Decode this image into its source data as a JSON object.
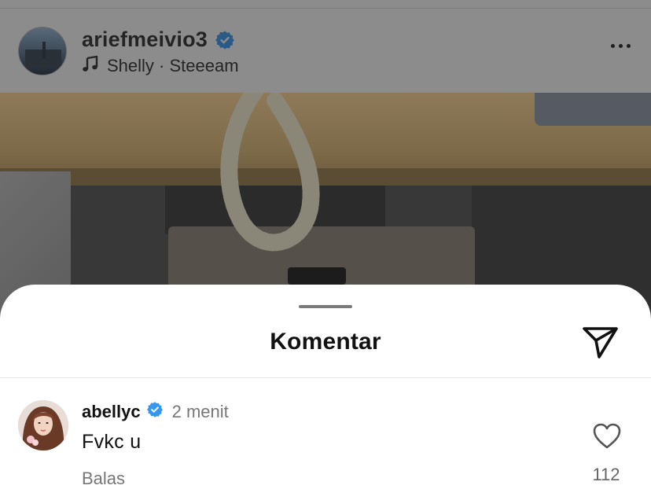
{
  "post": {
    "username": "ariefmeivio3",
    "music": "Shelly · Steeeam"
  },
  "sheet": {
    "title": "Komentar"
  },
  "comment": {
    "username": "abellyc",
    "time": "2 menit",
    "text": "Fvkc u",
    "reply_label": "Balas",
    "like_count": "112"
  },
  "colors": {
    "verified": "#3797f0",
    "overlay": "#8a8a8a",
    "sheet_bg": "#ffffff"
  },
  "icons": {
    "verified": "verified-badge-icon",
    "music": "music-note-icon",
    "more": "more-dots-icon",
    "send": "send-icon",
    "like": "heart-icon"
  }
}
